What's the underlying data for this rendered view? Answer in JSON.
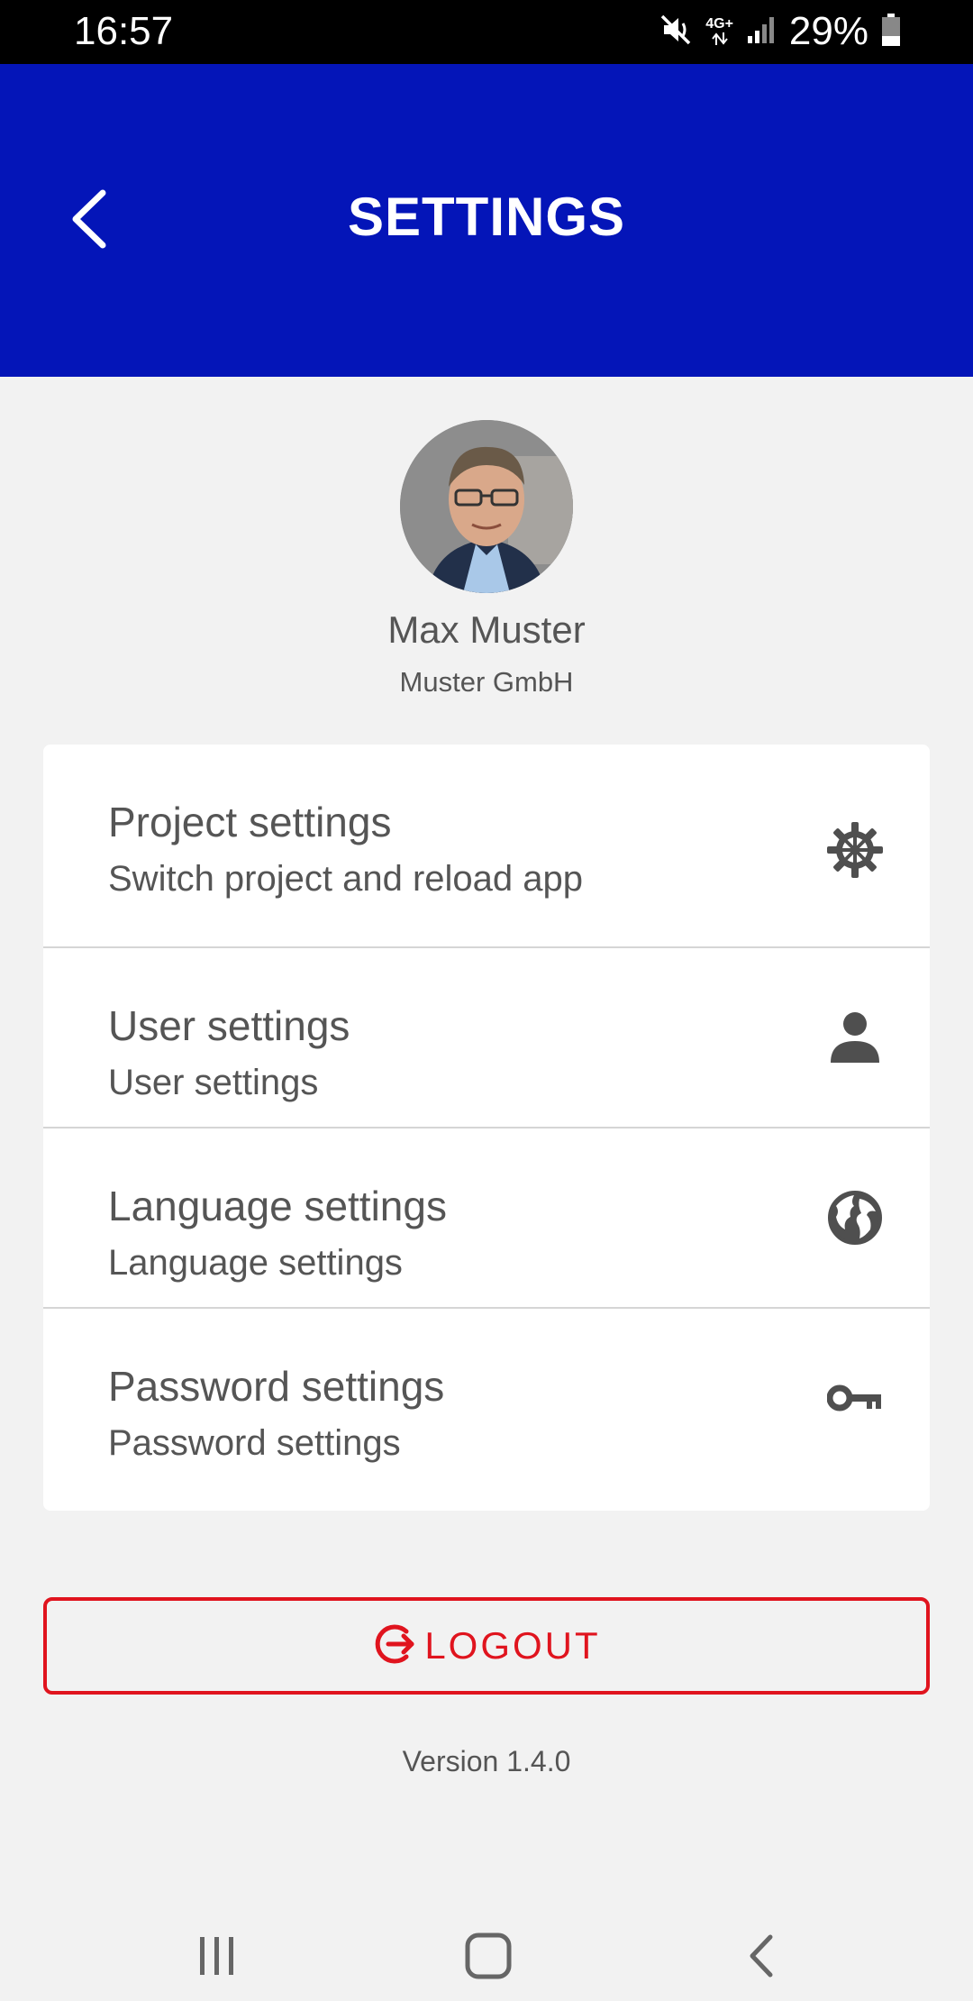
{
  "status_bar": {
    "time": "16:57",
    "network": "4G+",
    "battery": "29%",
    "icons": [
      "mute-icon",
      "signal-icon",
      "battery-icon"
    ]
  },
  "header": {
    "title": "SETTINGS",
    "back_icon": "chevron-left-icon",
    "background_color": "#0415b8"
  },
  "profile": {
    "name": "Max Muster",
    "company": "Muster GmbH"
  },
  "settings": {
    "items": [
      {
        "title": "Project settings",
        "subtitle": "Switch project and reload app",
        "icon": "gear-icon"
      },
      {
        "title": "User settings",
        "subtitle": "User settings",
        "icon": "person-icon"
      },
      {
        "title": "Language settings",
        "subtitle": "Language settings",
        "icon": "globe-icon"
      },
      {
        "title": "Password settings",
        "subtitle": "Password settings",
        "icon": "key-icon"
      }
    ]
  },
  "logout": {
    "label": "LOGOUT",
    "icon": "logout-icon",
    "color": "#e0141e"
  },
  "version": "Version 1.4.0",
  "nav": {
    "icons": [
      "recent-apps-icon",
      "home-icon",
      "back-icon"
    ]
  }
}
